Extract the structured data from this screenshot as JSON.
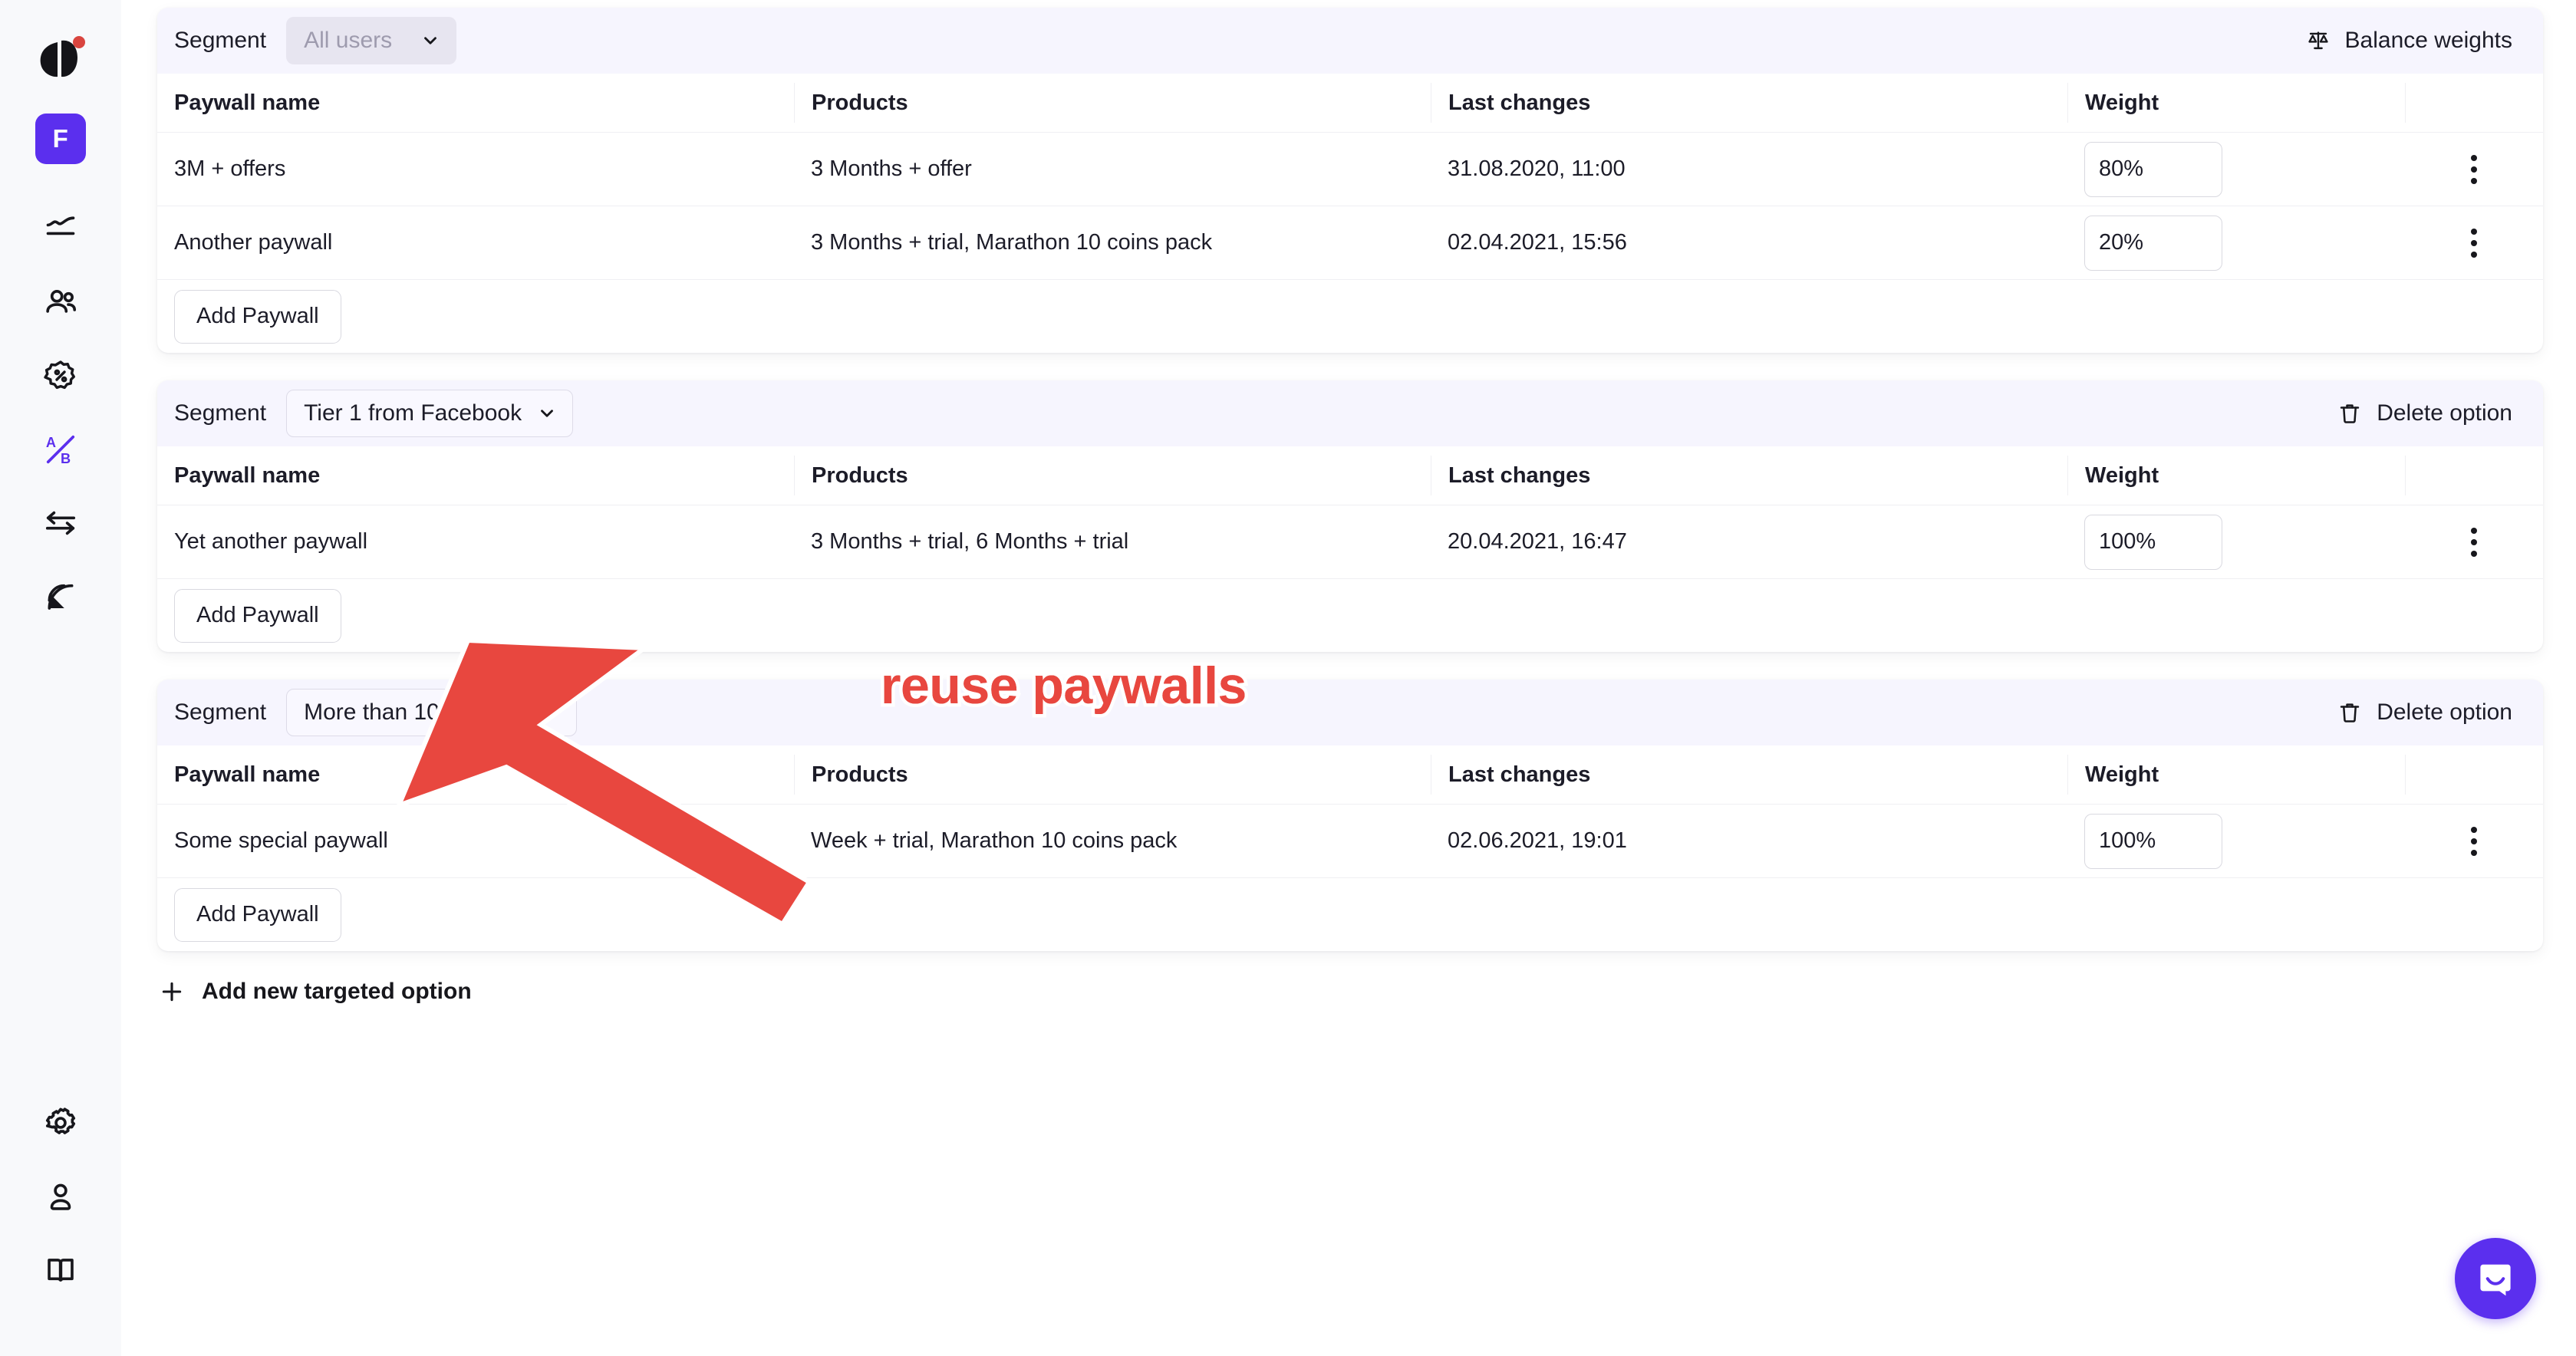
{
  "sidebar": {
    "logo": {
      "name": "app-logo",
      "notification_dot_color": "#D9453F"
    },
    "project_badge": {
      "label": "F",
      "color": "#5B2FEE"
    },
    "nav_items": [
      {
        "icon": "analytics-chart-icon",
        "name": "sidebar-item-analytics"
      },
      {
        "icon": "users-icon",
        "name": "sidebar-item-users"
      },
      {
        "icon": "discount-badge-icon",
        "name": "sidebar-item-offers"
      },
      {
        "icon": "ab-test-icon",
        "name": "sidebar-item-ab-tests",
        "active": true
      },
      {
        "icon": "integrations-arrows-icon",
        "name": "sidebar-item-integrations"
      },
      {
        "icon": "broadcast-icon",
        "name": "sidebar-item-events"
      }
    ],
    "bottom_items": [
      {
        "icon": "gear-icon",
        "name": "sidebar-item-settings"
      },
      {
        "icon": "user-icon",
        "name": "sidebar-item-account"
      },
      {
        "icon": "book-icon",
        "name": "sidebar-item-docs"
      }
    ]
  },
  "table_headers": {
    "paywall_name": "Paywall name",
    "products": "Products",
    "last_changes": "Last changes",
    "weight": "Weight"
  },
  "labels": {
    "segment": "Segment",
    "add_paywall": "Add Paywall",
    "balance_weights": "Balance weights",
    "delete_option": "Delete option",
    "add_new_targeted_option": "Add new targeted option"
  },
  "options": [
    {
      "segment_value": "All users",
      "segment_disabled": true,
      "action": {
        "type": "balance-weights",
        "label": "Balance weights",
        "icon": "scales-icon"
      },
      "rows": [
        {
          "paywall_name": "3M + offers",
          "products": "3 Months + offer",
          "last_changes": "31.08.2020, 11:00",
          "weight": "80%"
        },
        {
          "paywall_name": "Another paywall",
          "products": "3 Months + trial, Marathon 10 coins pack",
          "last_changes": "02.04.2021, 15:56",
          "weight": "20%"
        }
      ]
    },
    {
      "segment_value": "Tier 1 from Facebook",
      "segment_disabled": false,
      "action": {
        "type": "delete-option",
        "label": "Delete option",
        "icon": "trash-icon"
      },
      "rows": [
        {
          "paywall_name": "Yet another paywall",
          "products": "3 Months + trial, 6 Months + trial",
          "last_changes": "20.04.2021, 16:47",
          "weight": "100%"
        }
      ]
    },
    {
      "segment_value": "More than 10 pull ups",
      "segment_disabled": false,
      "action": {
        "type": "delete-option",
        "label": "Delete option",
        "icon": "trash-icon"
      },
      "rows": [
        {
          "paywall_name": "Some special paywall",
          "products": "Week + trial, Marathon 10 coins pack",
          "last_changes": "02.06.2021, 19:01",
          "weight": "100%"
        }
      ]
    }
  ],
  "annotation": {
    "text": "reuse paywalls",
    "color": "#E8473F",
    "arrow": "red-arrow-pointing-up-left"
  },
  "intercom": {
    "name": "intercom-chat-button",
    "color": "#5B2FEE"
  }
}
